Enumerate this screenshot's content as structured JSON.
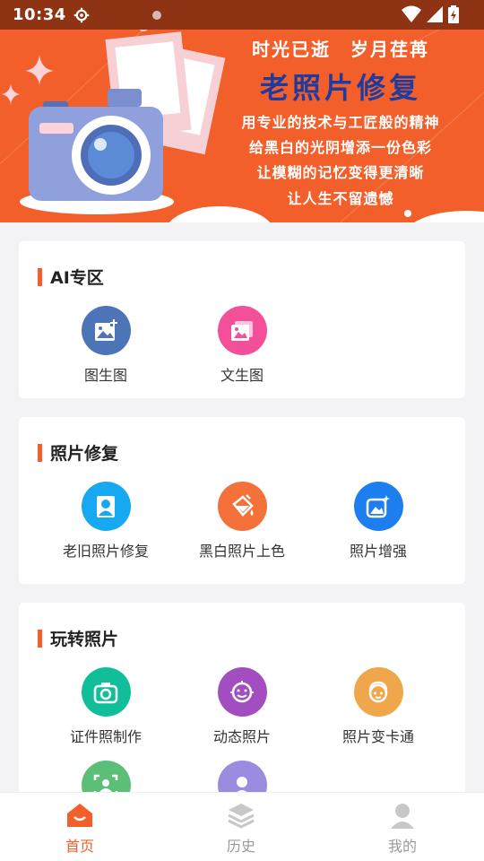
{
  "status_bar": {
    "time": "10:34"
  },
  "banner": {
    "line1": "时光已逝　岁月荏苒",
    "title": "老照片修复",
    "line3": "用专业的技术与工匠般的精神",
    "line4": "给黑白的光阴增添一份色彩",
    "line5": "让模糊的记忆变得更清晰",
    "line6": "让人生不留遗憾"
  },
  "sections": [
    {
      "title": "AI专区",
      "items": [
        {
          "label": "图生图",
          "icon": "image-plus-icon",
          "color": "#4e74b8"
        },
        {
          "label": "文生图",
          "icon": "gallery-icon",
          "color": "#f4509a"
        }
      ]
    },
    {
      "title": "照片修复",
      "items": [
        {
          "label": "老旧照片修复",
          "icon": "portrait-icon",
          "color": "#16a8f0"
        },
        {
          "label": "黑白照片上色",
          "icon": "paint-bucket-icon",
          "color": "#f4713a"
        },
        {
          "label": "照片增强",
          "icon": "image-sparkle-icon",
          "color": "#1d7ef0"
        }
      ]
    },
    {
      "title": "玩转照片",
      "items": [
        {
          "label": "证件照制作",
          "icon": "camera-icon",
          "color": "#10bf9a"
        },
        {
          "label": "动态照片",
          "icon": "smile-face-icon",
          "color": "#a34ec0"
        },
        {
          "label": "照片变卡通",
          "icon": "cartoon-face-icon",
          "color": "#f0a64a"
        },
        {
          "label": "",
          "icon": "face-scan-icon",
          "color": "#5cbf78"
        },
        {
          "label": "",
          "icon": "person-icon",
          "color": "#9b8ce0"
        }
      ]
    }
  ],
  "tabbar": [
    {
      "label": "首页",
      "icon": "home-icon",
      "active": true
    },
    {
      "label": "历史",
      "icon": "layers-icon",
      "active": false
    },
    {
      "label": "我的",
      "icon": "user-icon",
      "active": false
    }
  ],
  "colors": {
    "accent": "#f25f2a",
    "status_bar": "#8e3313"
  }
}
